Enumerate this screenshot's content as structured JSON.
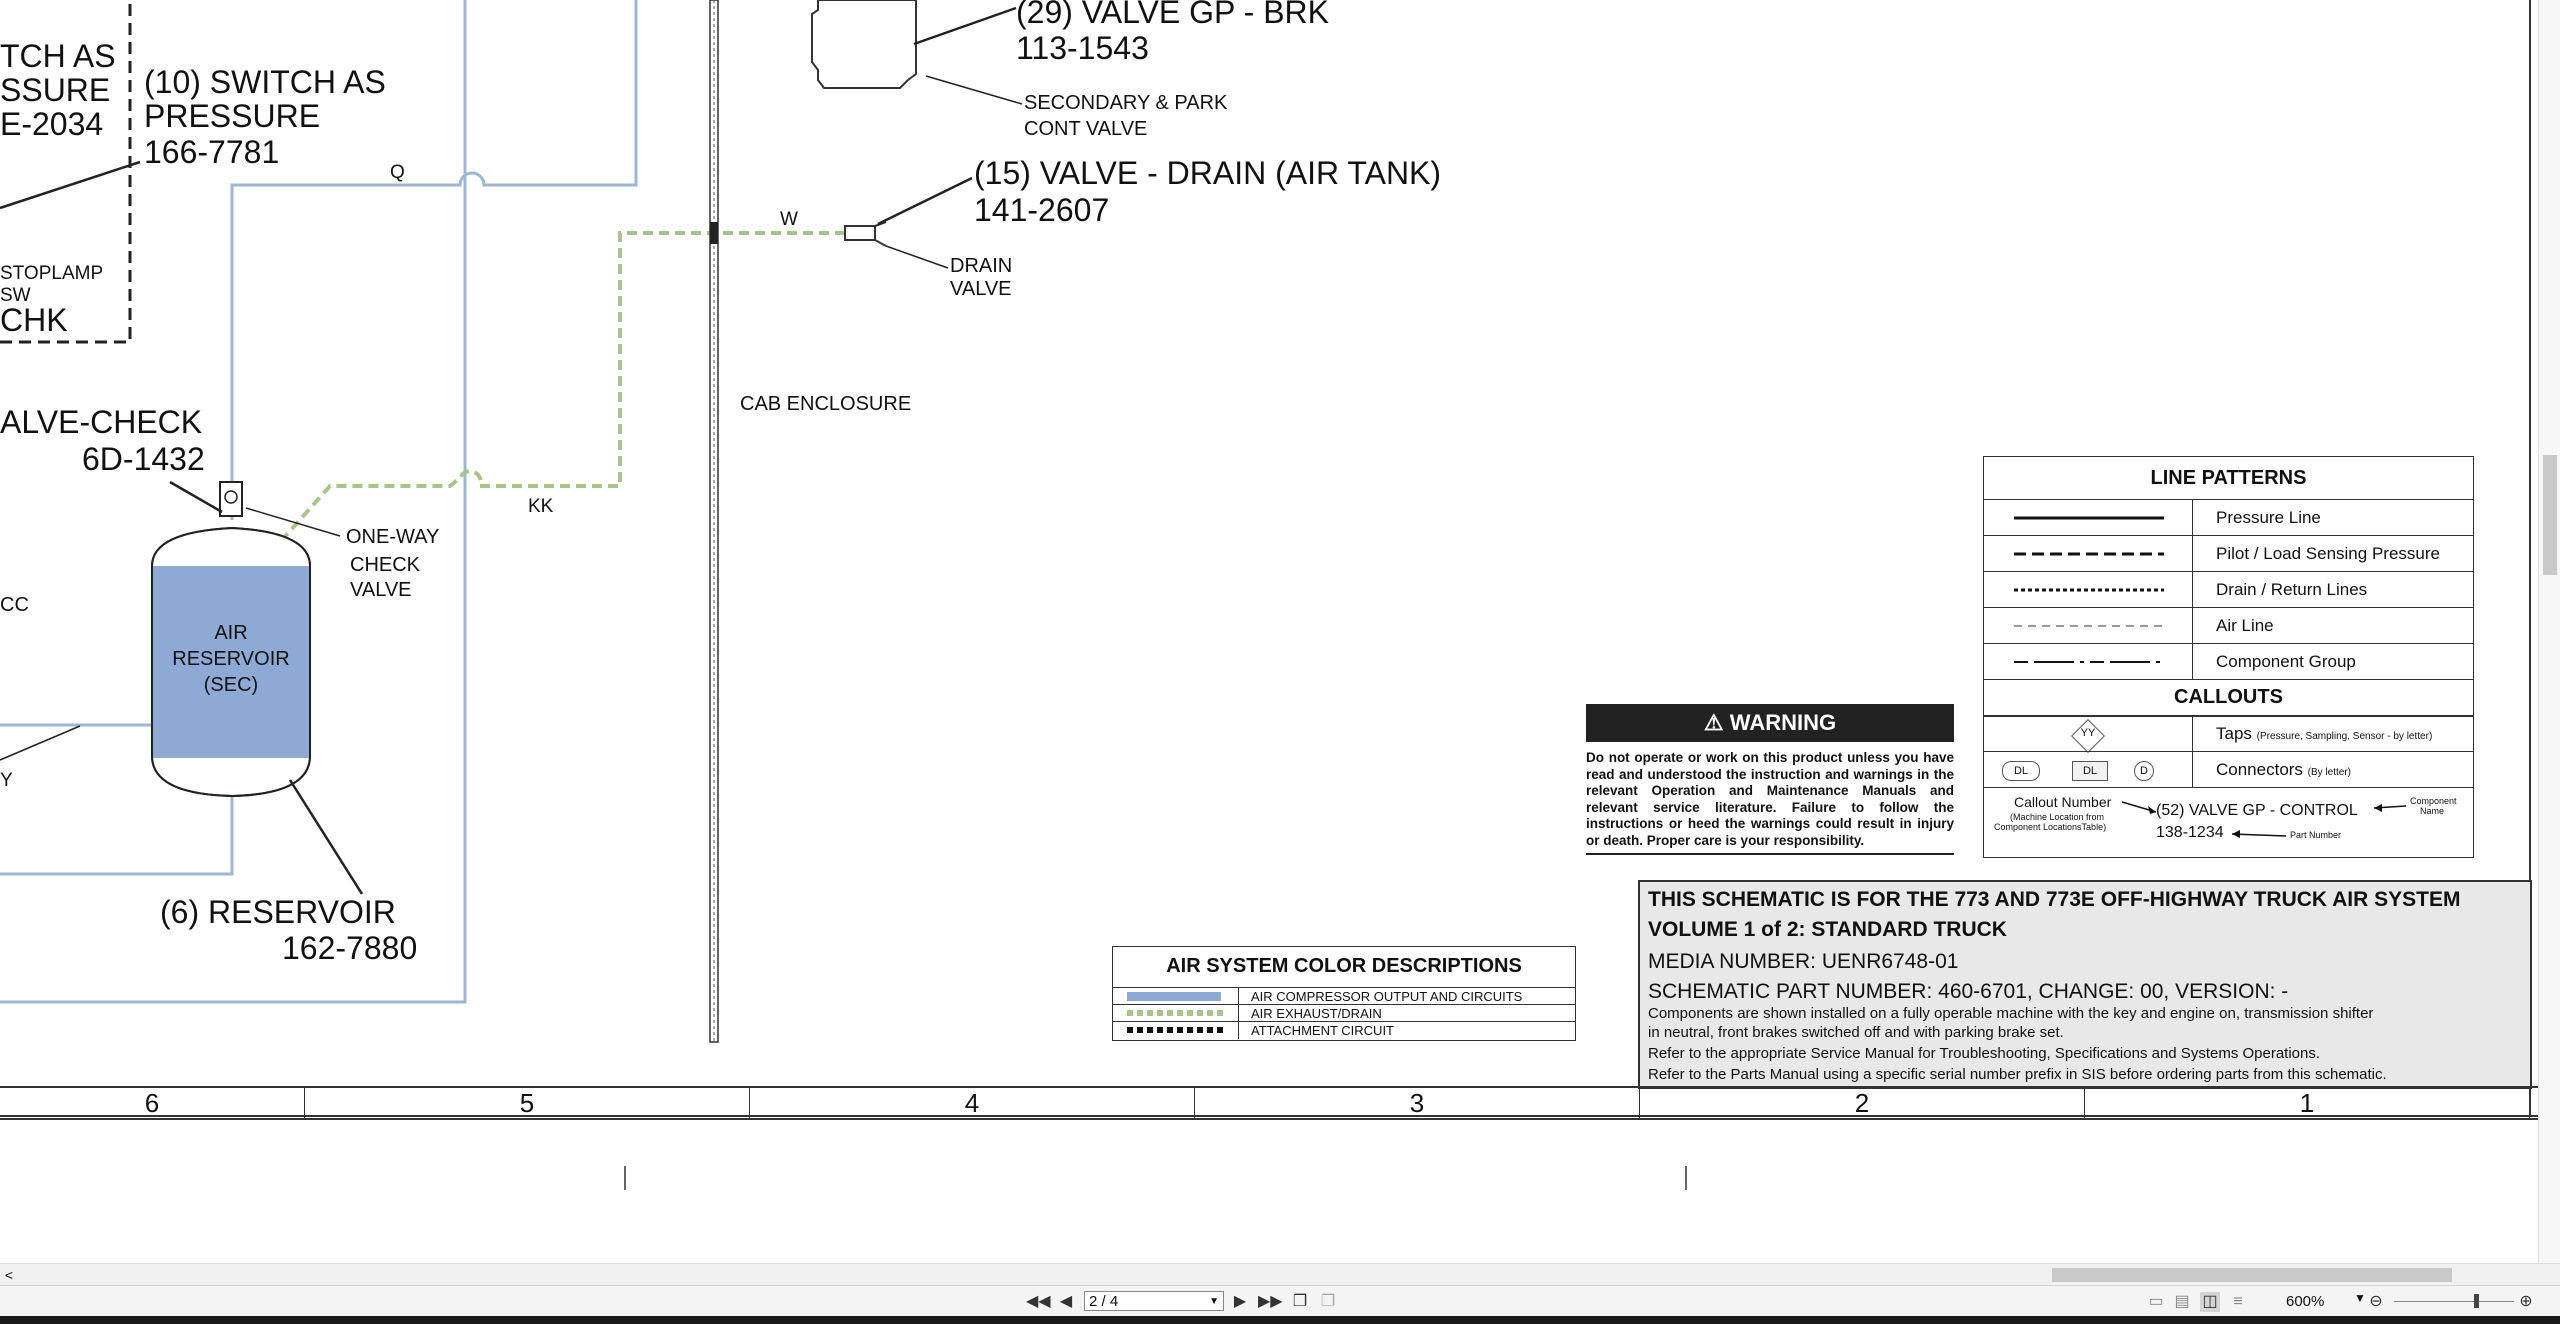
{
  "components": {
    "switch_left_1": "TCH AS",
    "switch_left_2": "SSURE",
    "switch_left_3": "E-2034",
    "switch10_title": "(10) SWITCH AS",
    "switch10_sub": "PRESSURE",
    "switch10_part": "166-7781",
    "stoplamp_1": "STOPLAMP",
    "stoplamp_2": "SW",
    "chk": "CHK",
    "check_valve_name": "ALVE-CHECK",
    "check_valve_part": "6D-1432",
    "oneway_1": "ONE-WAY",
    "oneway_2": "CHECK",
    "oneway_3": "VALVE",
    "reservoir_1": "AIR",
    "reservoir_2": "RESERVOIR",
    "reservoir_3": "(SEC)",
    "reservoir6_name": "(6) RESERVOIR",
    "reservoir6_part": "162-7880",
    "valve29_name": "(29) VALVE GP - BRK",
    "valve29_part": "113-1543",
    "secondary_1": "SECONDARY & PARK",
    "secondary_2": "CONT VALVE",
    "valve15_name": "(15) VALVE - DRAIN (AIR TANK)",
    "valve15_part": "141-2607",
    "drain_1": "DRAIN",
    "drain_2": "VALVE",
    "cab": "CAB ENCLOSURE",
    "wire_q": "Q",
    "wire_w": "W",
    "wire_kk": "KK",
    "wire_cc": "CC",
    "wire_y": "Y"
  },
  "line_patterns": {
    "title": "LINE PATTERNS",
    "rows": [
      "Pressure Line",
      "Pilot / Load Sensing Pressure",
      "Drain / Return Lines",
      "Air Line",
      "Component Group"
    ],
    "callouts_title": "CALLOUTS",
    "taps_label": "Taps",
    "taps_note": "(Pressure, Sampling, Sensor - by letter)",
    "taps_symbol": "YY",
    "connectors_label": "Connectors",
    "connectors_note": "(By letter)",
    "conn_sym_1": "DL",
    "conn_sym_2": "DL",
    "conn_sym_3": "D",
    "callout_number": "Callout Number",
    "callout_note_1": "(Machine Location from",
    "callout_note_2": "Component LocationsTable)",
    "callout_example": "(52) VALVE GP - CONTROL",
    "callout_part": "138-1234",
    "component_name_1": "Component",
    "component_name_2": "Name",
    "part_number": "Part Number"
  },
  "warning": {
    "title": "WARNING",
    "body": "Do not operate or work on this product unless you have read and understood the instruction and warnings in the relevant Operation and Maintenance Manuals and relevant service literature. Failure to follow the instructions or heed the warnings could result in injury or death. Proper care is your responsibility."
  },
  "title_block": {
    "line1": "THIS SCHEMATIC IS FOR THE 773 AND 773E OFF-HIGHWAY TRUCK AIR SYSTEM",
    "line2": "VOLUME 1 of 2: STANDARD TRUCK",
    "line3": "MEDIA NUMBER: UENR6748-01",
    "line4": "SCHEMATIC PART NUMBER: 460-6701, CHANGE: 00, VERSION: -",
    "line5": "Components are shown installed on a fully operable machine with the key and engine on, transmission shifter",
    "line6": "in neutral, front brakes switched off and with parking brake set.",
    "line7": "Refer to the appropriate Service Manual for Troubleshooting, Specifications and Systems Operations.",
    "line8": "Refer to the Parts Manual using a specific serial number prefix in SIS before ordering parts from this schematic."
  },
  "color_desc": {
    "title": "AIR SYSTEM COLOR DESCRIPTIONS",
    "rows": [
      "AIR COMPRESSOR OUTPUT AND CIRCUITS",
      "AIR EXHAUST/DRAIN",
      "ATTACHMENT CIRCUIT"
    ],
    "colors": [
      "#8eaad4",
      "#a9c48a",
      "#111111"
    ]
  },
  "zones": [
    "6",
    "5",
    "4",
    "3",
    "2",
    "1"
  ],
  "viewer": {
    "page_field": "2 / 4",
    "zoom": "600%",
    "scroll_left": "<"
  },
  "colors": {
    "air_line": "#9db6d6",
    "exhaust": "#a9c48a",
    "reservoir_fill": "#8eaad4"
  }
}
